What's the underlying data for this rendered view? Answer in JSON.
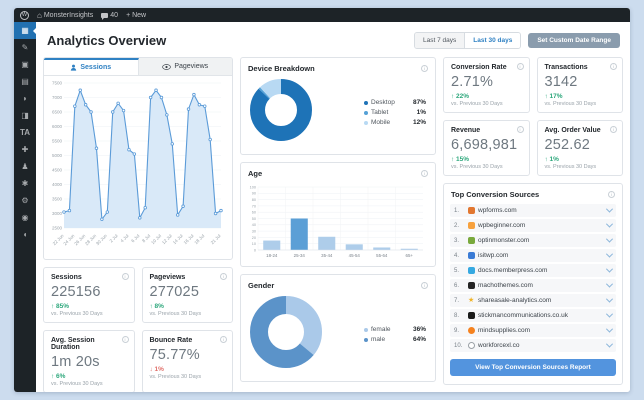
{
  "admin_bar": {
    "site_name": "MonsterInsights",
    "comment_count": "40",
    "new_label": "+ New"
  },
  "sidebar": {
    "items": [
      {
        "name": "dashboard",
        "glyph": "▦",
        "active": true
      },
      {
        "name": "posts",
        "glyph": "✎"
      },
      {
        "name": "media",
        "glyph": "▣"
      },
      {
        "name": "pages",
        "glyph": "▤"
      },
      {
        "name": "comments",
        "glyph": "◗"
      },
      {
        "name": "appearance",
        "glyph": "◨"
      },
      {
        "name": "plugin-ta",
        "glyph": "TA"
      },
      {
        "name": "plugins",
        "glyph": "✚"
      },
      {
        "name": "users",
        "glyph": "♟"
      },
      {
        "name": "tools",
        "glyph": "✱"
      },
      {
        "name": "settings",
        "glyph": "⚙"
      },
      {
        "name": "insights",
        "glyph": "◉"
      },
      {
        "name": "collapse-menu",
        "glyph": "◖"
      }
    ]
  },
  "header": {
    "title": "Analytics Overview",
    "last7_label": "Last 7 days",
    "last30_label": "Last 30 days",
    "active_range": "Last 30 days",
    "custom_label": "Set Custom Date Range"
  },
  "tabs": {
    "sessions_label": "Sessions",
    "pageviews_label": "Pageviews"
  },
  "stats_left": [
    {
      "key": "sessions",
      "label": "Sessions",
      "value": "225156",
      "change": "↑ 85%",
      "trend": "up",
      "sub": "vs. Previous 30 Days"
    },
    {
      "key": "pageviews",
      "label": "Pageviews",
      "value": "277025",
      "change": "↑ 8%",
      "trend": "up",
      "sub": "vs. Previous 30 Days"
    },
    {
      "key": "avg-session-duration",
      "label": "Avg. Session Duration",
      "value": "1m 20s",
      "change": "↑ 6%",
      "trend": "up",
      "sub": "vs. Previous 30 Days"
    },
    {
      "key": "bounce-rate",
      "label": "Bounce Rate",
      "value": "75.77%",
      "change": "↓ 1%",
      "trend": "down",
      "sub": "vs. Previous 30 Days"
    }
  ],
  "stats_right": [
    {
      "key": "conversion-rate",
      "label": "Conversion Rate",
      "value": "2.71%",
      "change": "↑ 22%",
      "trend": "up",
      "sub": "vs. Previous 30 Days"
    },
    {
      "key": "transactions",
      "label": "Transactions",
      "value": "3142",
      "change": "↑ 17%",
      "trend": "up",
      "sub": "vs. Previous 30 Days"
    },
    {
      "key": "revenue",
      "label": "Revenue",
      "value": "6,698,981",
      "change": "↑ 15%",
      "trend": "up",
      "sub": "vs. Previous 30 Days"
    },
    {
      "key": "avg-order-value",
      "label": "Avg. Order Value",
      "value": "252.62",
      "change": "↑ 1%",
      "trend": "up",
      "sub": "vs. Previous 30 Days"
    }
  ],
  "sources": {
    "title": "Top Conversion Sources",
    "button_label": "View Top Conversion Sources Report",
    "items": [
      {
        "rank": "1.",
        "domain": "wpforms.com",
        "icon_color": "#e27730",
        "icon_shape": "square"
      },
      {
        "rank": "2.",
        "domain": "wpbeginner.com",
        "icon_color": "#f7a13d",
        "icon_shape": "square"
      },
      {
        "rank": "3.",
        "domain": "optinmonster.com",
        "icon_color": "#79a93c",
        "icon_shape": "square"
      },
      {
        "rank": "4.",
        "domain": "isitwp.com",
        "icon_color": "#3a7bd5",
        "icon_shape": "square"
      },
      {
        "rank": "5.",
        "domain": "docs.memberpress.com",
        "icon_color": "#36a9e1",
        "icon_shape": "square"
      },
      {
        "rank": "6.",
        "domain": "machothemes.com",
        "icon_color": "#232323",
        "icon_shape": "square"
      },
      {
        "rank": "7.",
        "domain": "shareasale-analytics.com",
        "icon_color": "#f0b429",
        "icon_shape": "star"
      },
      {
        "rank": "8.",
        "domain": "stickmancommunications.co.uk",
        "icon_color": "#1a1a1a",
        "icon_shape": "square"
      },
      {
        "rank": "9.",
        "domain": "mindsupplies.com",
        "icon_color": "#f5821f",
        "icon_shape": "circle"
      },
      {
        "rank": "10.",
        "domain": "workforcexl.co",
        "icon_color": "#9aa0a6",
        "icon_shape": "globe"
      }
    ]
  },
  "colors": {
    "accent_blue": "#2f81c3",
    "green_up": "#2ca77b",
    "red_down": "#e0706a",
    "report_button": "#5394de",
    "custom_range_button": "#8a9cad"
  },
  "chart_data": [
    {
      "id": "sessions",
      "type": "line",
      "title": "Sessions",
      "ylim": [
        2500,
        7500
      ],
      "ystep": 500,
      "values": [
        3050,
        3100,
        6700,
        7250,
        6750,
        6500,
        5250,
        2800,
        3050,
        6500,
        6800,
        6550,
        5200,
        5050,
        2850,
        3200,
        7000,
        7250,
        7000,
        6400,
        5400,
        2950,
        3250,
        6600,
        7100,
        6750,
        6700,
        5550,
        3000,
        3100
      ],
      "xticks": [
        "22 Jun",
        "24 Jun",
        "26 Jun",
        "28 Jun",
        "30 Jun",
        "2 Jul",
        "4 Jul",
        "6 Jul",
        "8 Jul",
        "10 Jul",
        "12 Jul",
        "14 Jul",
        "16 Jul",
        "18 Jul",
        "21 Jul"
      ],
      "xtick_indices": [
        0,
        2,
        4,
        6,
        8,
        10,
        12,
        14,
        16,
        18,
        20,
        22,
        24,
        26,
        29
      ],
      "stroke": "#5b9bd8",
      "fill": "#d9e9f8",
      "grid": true,
      "legend_position": "none"
    },
    {
      "id": "device",
      "type": "pie",
      "title": "Device Breakdown",
      "legend_position": "right",
      "slices": [
        {
          "label": "Desktop",
          "value": 87,
          "display": "87%",
          "color": "#1e73b7"
        },
        {
          "label": "Tablet",
          "value": 1,
          "display": "1%",
          "color": "#55a1d6"
        },
        {
          "label": "Mobile",
          "value": 12,
          "display": "12%",
          "color": "#b8d9f3"
        }
      ]
    },
    {
      "id": "age",
      "type": "bar",
      "title": "Age",
      "categories": [
        "18-24",
        "25-34",
        "35-44",
        "45-54",
        "55-64",
        "65+"
      ],
      "values": [
        15,
        50,
        21,
        9,
        4,
        2
      ],
      "ylim": [
        0,
        100
      ],
      "ystep": 10,
      "grid": true,
      "bar_colors": [
        "#aecdea",
        "#5b9fd6",
        "#aecdea",
        "#aecdea",
        "#aecdea",
        "#aecdea"
      ]
    },
    {
      "id": "gender",
      "type": "pie",
      "title": "Gender",
      "legend_position": "right",
      "slices": [
        {
          "label": "female",
          "value": 36,
          "display": "36%",
          "color": "#aac9e9"
        },
        {
          "label": "male",
          "value": 64,
          "display": "64%",
          "color": "#5b93c9"
        }
      ]
    }
  ]
}
